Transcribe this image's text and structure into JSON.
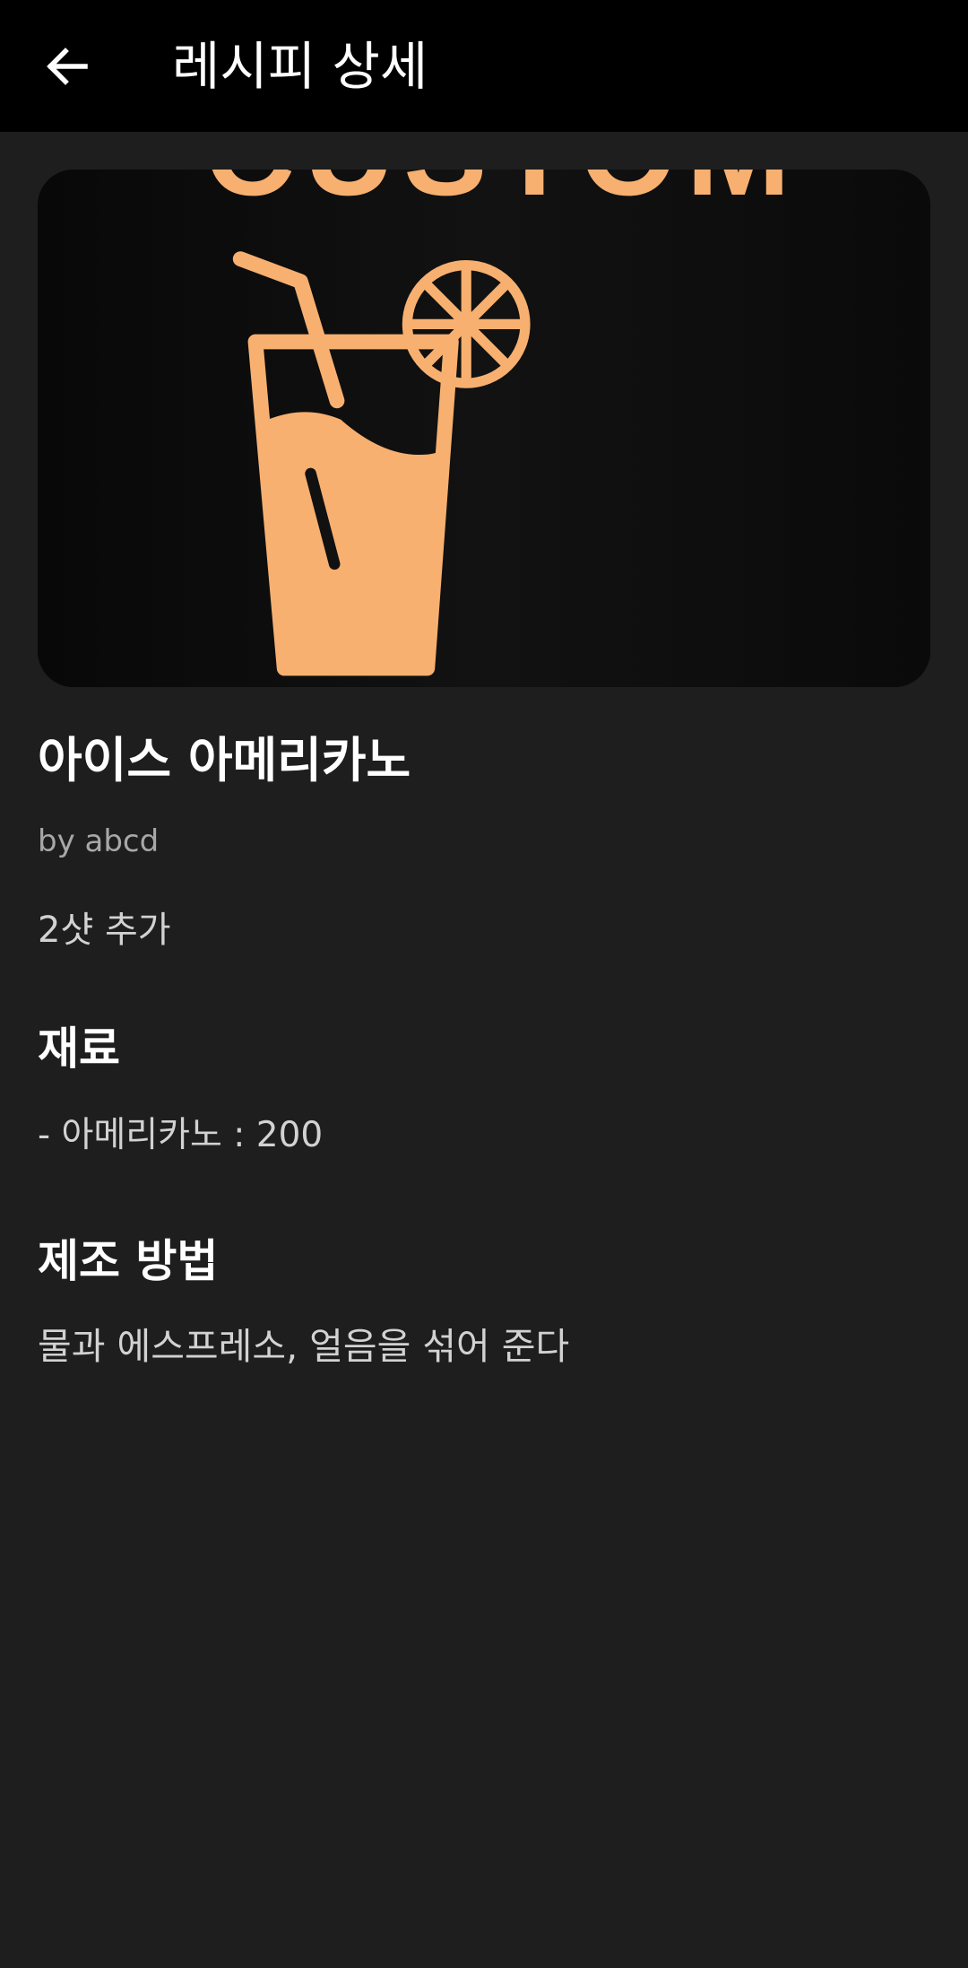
{
  "app_bar": {
    "title": "레시피 상세",
    "back_icon": "arrow-left-icon",
    "background": "#000000"
  },
  "hero": {
    "banner_text": "CUSTOM",
    "illustration": "iced-drink-icon",
    "accent_color": "#f7b070"
  },
  "recipe": {
    "title": "아이스 아메리카노",
    "author": "by abcd",
    "description": "2샷 추가"
  },
  "ingredients": {
    "heading": "재료",
    "items": [
      "- 아메리카노 : 200"
    ]
  },
  "method": {
    "heading": "제조 방법",
    "text": "물과 에스프레소, 얼음을 섞어 준다"
  }
}
